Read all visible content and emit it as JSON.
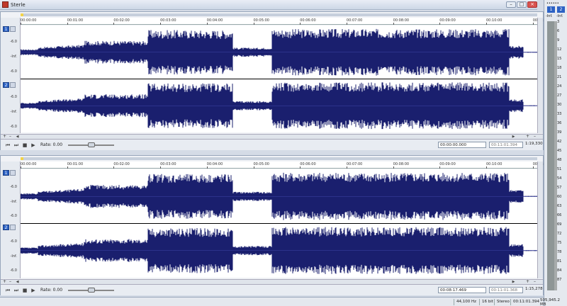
{
  "window": {
    "title": "Sterle"
  },
  "ruler_ticks": [
    "00:00:00",
    "00:01:00",
    "00:02:00",
    "00:03:00",
    "00:04:00",
    "00:05:00",
    "00:06:00",
    "00:07:00",
    "00:08:00",
    "00:09:00",
    "00:10:00",
    "00:11:00"
  ],
  "db_labels": [
    "-6.0",
    "-Inf.",
    "-6.0"
  ],
  "editors": [
    {
      "channels": [
        "1",
        "2"
      ],
      "rate_label": "Rate: 0.00",
      "cursor_time": "00:00:00.000",
      "length_time": "00:11:01.394",
      "zoom": "1:19,330"
    },
    {
      "channels": [
        "1",
        "2"
      ],
      "rate_label": "Rate: 0.00",
      "cursor_time": "00:08:17.469",
      "length_time": "00:11:01.368",
      "zoom": "1:15,278"
    }
  ],
  "status": {
    "sample_rate": "44,100 Hz",
    "bit_depth": "16 bit",
    "channels": "Stereo",
    "duration": "00:11:01.394",
    "size": "505,945.2 MB"
  },
  "meter": {
    "dots": "••••••",
    "channels": [
      "1",
      "2"
    ],
    "clip_labels": [
      "-Inf.",
      "-Inf."
    ],
    "scale": [
      "3",
      "6",
      "9",
      "12",
      "15",
      "18",
      "21",
      "24",
      "27",
      "30",
      "33",
      "36",
      "39",
      "42",
      "45",
      "48",
      "51",
      "54",
      "57",
      "60",
      "63",
      "66",
      "69",
      "72",
      "75",
      "78",
      "81",
      "84",
      "87"
    ]
  },
  "colors": {
    "waveform": "#1a1f6e",
    "waveform_light": "#3d46a8",
    "accent": "#2d62c4"
  }
}
